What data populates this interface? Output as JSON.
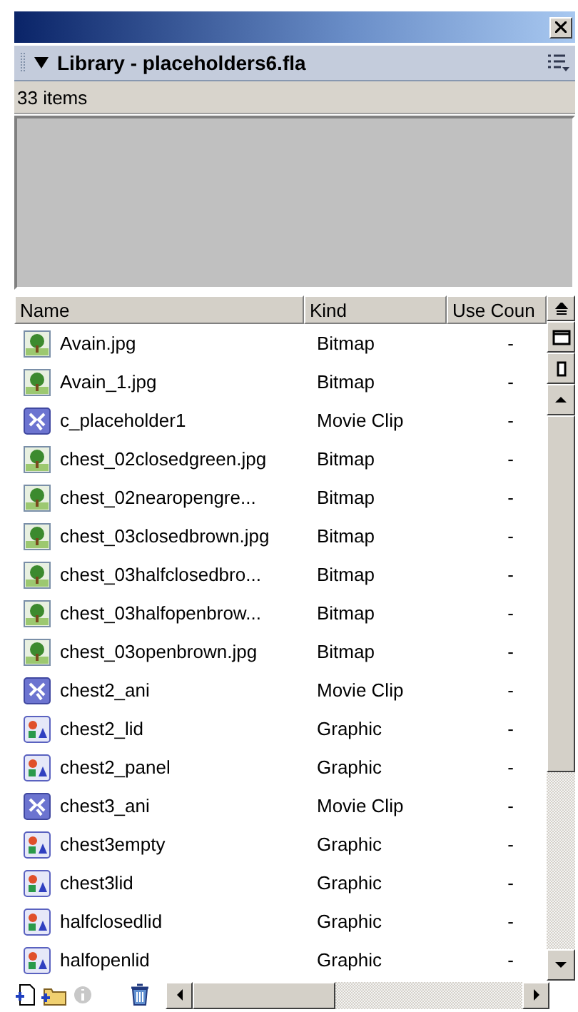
{
  "panel": {
    "title": "Library - placeholders6.fla",
    "item_count": "33 items"
  },
  "table": {
    "columns": [
      "Name",
      "Kind",
      "Use Coun"
    ],
    "rows": [
      {
        "name": "Avain.jpg",
        "type": "Bitmap",
        "use_count": "-",
        "kind": "bitmap"
      },
      {
        "name": "Avain_1.jpg",
        "type": "Bitmap",
        "use_count": "-",
        "kind": "bitmap"
      },
      {
        "name": "c_placeholder1",
        "type": "Movie Clip",
        "use_count": "-",
        "kind": "movieclip"
      },
      {
        "name": "chest_02closedgreen.jpg",
        "type": "Bitmap",
        "use_count": "-",
        "kind": "bitmap"
      },
      {
        "name": "chest_02nearopengre...",
        "type": "Bitmap",
        "use_count": "-",
        "kind": "bitmap"
      },
      {
        "name": "chest_03closedbrown.jpg",
        "type": "Bitmap",
        "use_count": "-",
        "kind": "bitmap"
      },
      {
        "name": "chest_03halfclosedbro...",
        "type": "Bitmap",
        "use_count": "-",
        "kind": "bitmap"
      },
      {
        "name": "chest_03halfopenbrow...",
        "type": "Bitmap",
        "use_count": "-",
        "kind": "bitmap"
      },
      {
        "name": "chest_03openbrown.jpg",
        "type": "Bitmap",
        "use_count": "-",
        "kind": "bitmap"
      },
      {
        "name": "chest2_ani",
        "type": "Movie Clip",
        "use_count": "-",
        "kind": "movieclip"
      },
      {
        "name": "chest2_lid",
        "type": "Graphic",
        "use_count": "-",
        "kind": "graphic"
      },
      {
        "name": "chest2_panel",
        "type": "Graphic",
        "use_count": "-",
        "kind": "graphic"
      },
      {
        "name": "chest3_ani",
        "type": "Movie Clip",
        "use_count": "-",
        "kind": "movieclip"
      },
      {
        "name": "chest3empty",
        "type": "Graphic",
        "use_count": "-",
        "kind": "graphic"
      },
      {
        "name": "chest3lid",
        "type": "Graphic",
        "use_count": "-",
        "kind": "graphic"
      },
      {
        "name": "halfclosedlid",
        "type": "Graphic",
        "use_count": "-",
        "kind": "graphic"
      },
      {
        "name": "halfopenlid",
        "type": "Graphic",
        "use_count": "-",
        "kind": "graphic"
      }
    ]
  }
}
